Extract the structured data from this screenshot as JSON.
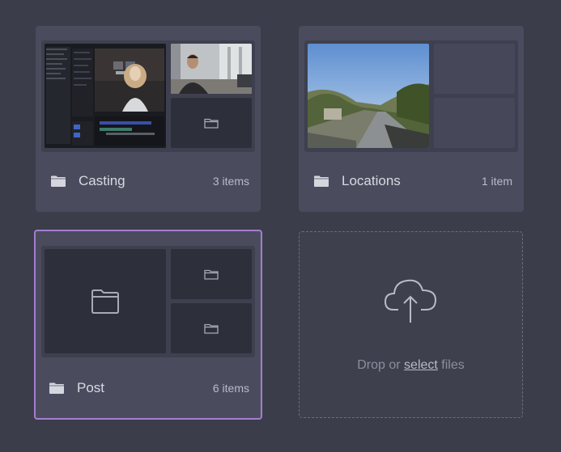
{
  "folders": [
    {
      "name": "Casting",
      "count": "3 items"
    },
    {
      "name": "Locations",
      "count": "1 item"
    },
    {
      "name": "Post",
      "count": "6 items"
    }
  ],
  "dropzone": {
    "text_before": "Drop or",
    "link": "select",
    "text_after": "files"
  },
  "colors": {
    "background": "#3b3d4a",
    "card": "#4a4c5e",
    "selected_border": "#a57ed0"
  },
  "icons": {
    "folder": "folder-icon",
    "upload": "cloud-upload-icon"
  }
}
